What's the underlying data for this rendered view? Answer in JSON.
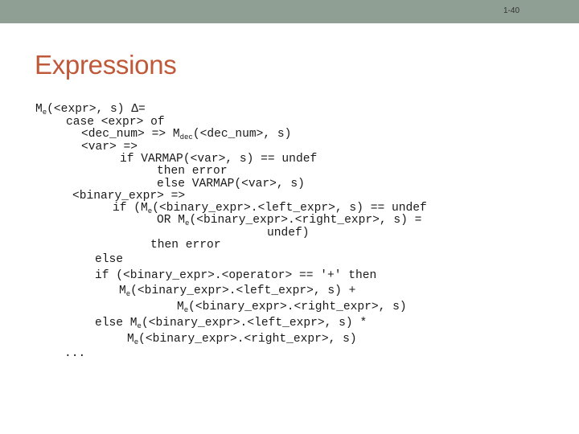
{
  "header": {
    "slide_number": "1-40"
  },
  "title": "Expressions",
  "code_lines": [
    {
      "pre": "M",
      "sub": "e",
      "post": "(<expr>, s) Δ="
    },
    {
      "pre": "case <expr> of",
      "sub": "",
      "post": ""
    },
    {
      "pre": "<dec_num> => M",
      "sub": "dec",
      "post": "(<dec_num>, s)"
    },
    {
      "pre": "<var> =>",
      "sub": "",
      "post": ""
    },
    {
      "pre": "if VARMAP(<var>, s) == undef",
      "sub": "",
      "post": ""
    },
    {
      "pre": "then error",
      "sub": "",
      "post": ""
    },
    {
      "pre": "else VARMAP(<var>, s)",
      "sub": "",
      "post": ""
    },
    {
      "pre": "<binary_expr> =>",
      "sub": "",
      "post": ""
    },
    {
      "pre": "if (M",
      "sub": "e",
      "post": "(<binary_expr>.<left_expr>, s) == undef"
    },
    {
      "pre": "OR M",
      "sub": "e",
      "post": "(<binary_expr>.<right_expr>, s) ="
    },
    {
      "pre": "undef)",
      "sub": "",
      "post": ""
    },
    {
      "pre": "then error",
      "sub": "",
      "post": ""
    },
    {
      "pre": "else",
      "sub": "",
      "post": ""
    },
    {
      "pre": "if (<binary_expr>.<operator> == '+' then",
      "sub": "",
      "post": ""
    },
    {
      "pre": "M",
      "sub": "e",
      "post": "(<binary_expr>.<left_expr>, s) +"
    },
    {
      "pre": "M",
      "sub": "e",
      "post": "(<binary_expr>.<right_expr>, s)"
    },
    {
      "pre": "else M",
      "sub": "e",
      "post": "(<binary_expr>.<left_expr>, s) *"
    },
    {
      "pre": "M",
      "sub": "e",
      "post": "(<binary_expr>.<right_expr>, s)"
    },
    {
      "pre": "...",
      "sub": "",
      "post": ""
    }
  ]
}
